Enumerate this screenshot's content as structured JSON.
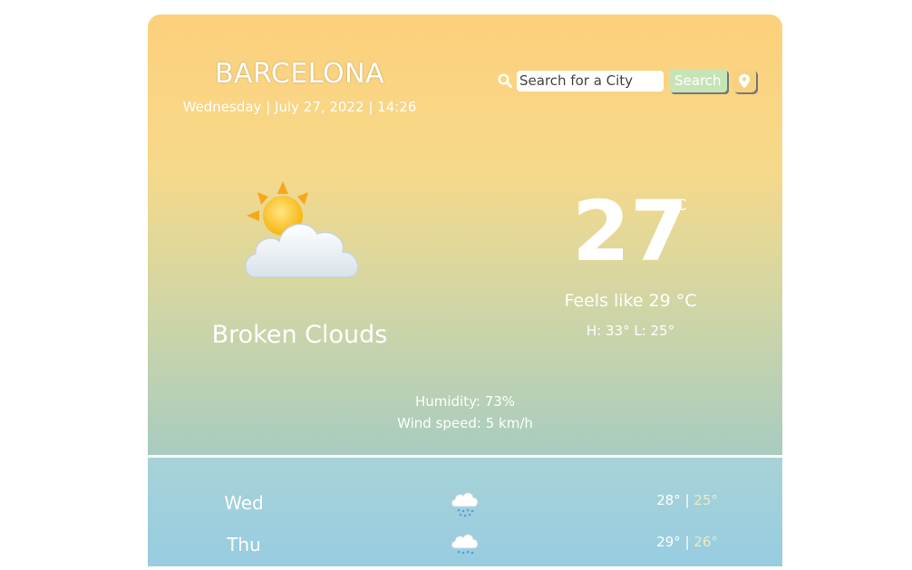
{
  "city": "BARCELONA",
  "datetime": "Wednesday | July 27, 2022 | 14:26",
  "search": {
    "placeholder": "Search for a City",
    "button_label": "Search"
  },
  "current": {
    "icon": "sun-behind-cloud-icon",
    "description": "Broken Clouds",
    "temperature": "27",
    "unit": "°C",
    "feels_like": "Feels like 29 °C",
    "high_low": "H: 33° L: 25°",
    "humidity": "Humidity: 73%",
    "wind": "Wind speed: 5 km/h"
  },
  "forecast": [
    {
      "day": "Wed",
      "icon": "snow-cloud-icon",
      "high": "28°",
      "low": "25°"
    },
    {
      "day": "Thu",
      "icon": "snow-cloud-icon",
      "high": "29°",
      "low": "26°"
    }
  ],
  "colors": {
    "accent_top": "#fdd07c",
    "accent_bottom": "#a8ccc0",
    "forecast_bg": "#97cce0",
    "search_button": "#c7e4b7"
  }
}
